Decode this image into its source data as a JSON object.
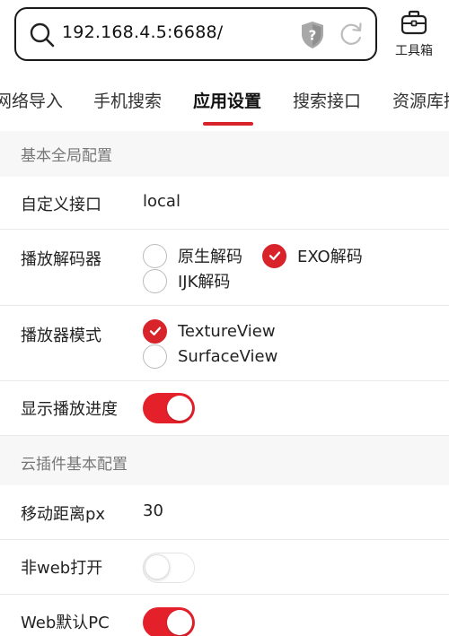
{
  "browser": {
    "url": "192.168.4.5:6688/",
    "toolbox_label": "工具箱"
  },
  "tabs": [
    {
      "label": "网络导入",
      "active": false
    },
    {
      "label": "手机搜索",
      "active": false
    },
    {
      "label": "应用设置",
      "active": true
    },
    {
      "label": "搜索接口",
      "active": false
    },
    {
      "label": "资源库接",
      "active": false
    }
  ],
  "sections": {
    "global": "基本全局配置",
    "cloud": "云插件基本配置"
  },
  "settings": {
    "custom_api": {
      "label": "自定义接口",
      "value": "local"
    },
    "decoder": {
      "label": "播放解码器",
      "options": [
        "原生解码",
        "EXO解码",
        "IJK解码"
      ],
      "selected": "EXO解码"
    },
    "player_mode": {
      "label": "播放器模式",
      "options": [
        "TextureView",
        "SurfaceView"
      ],
      "selected": "TextureView"
    },
    "show_progress": {
      "label": "显示播放进度",
      "enabled": true
    },
    "move_distance": {
      "label": "移动距离px",
      "value": "30"
    },
    "non_web_open": {
      "label": "非web打开",
      "enabled": false
    },
    "web_default_pc": {
      "label": "Web默认PC",
      "enabled": true
    }
  },
  "colors": {
    "accent": "#d8232a",
    "section_text": "#777777",
    "page_bg": "#f7f7f7"
  },
  "icons": {
    "search": "search-icon",
    "shield": "shield-icon",
    "refresh": "refresh-icon",
    "toolbox": "toolbox-icon",
    "check": "check-icon"
  }
}
